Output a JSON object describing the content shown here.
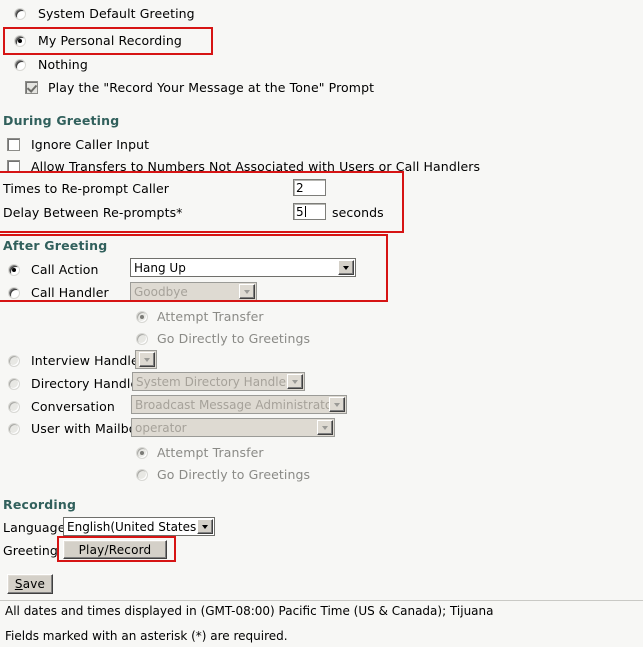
{
  "greeting_source": {
    "options": [
      {
        "label": "System Default Greeting",
        "selected": false
      },
      {
        "label": "My Personal Recording",
        "selected": true
      },
      {
        "label": "Nothing",
        "selected": false
      }
    ],
    "record_prompt_checkbox": {
      "label": "Play the \"Record Your Message at the Tone\" Prompt",
      "checked": true,
      "disabled": true
    }
  },
  "during_greeting": {
    "heading": "During Greeting",
    "ignore_caller_input": {
      "label": "Ignore Caller Input",
      "checked": false
    },
    "allow_transfers": {
      "label": "Allow Transfers to Numbers Not Associated with Users or Call Handlers",
      "checked": false
    },
    "times_to_reprompt": {
      "label": "Times to Re-prompt Caller",
      "value": "2"
    },
    "delay_between_reprompts": {
      "label": "Delay Between Re-prompts*",
      "value": "5",
      "units": "seconds"
    }
  },
  "after_greeting": {
    "heading": "After Greeting",
    "call_action": {
      "label": "Call Action",
      "selected": true,
      "value": "Hang Up",
      "disabled": false
    },
    "call_handler": {
      "label": "Call Handler",
      "selected": false,
      "value": "Goodbye",
      "disabled": true
    },
    "handler_transfer_options": [
      {
        "label": "Attempt Transfer",
        "selected": true,
        "disabled": true
      },
      {
        "label": "Go Directly to Greetings",
        "selected": false,
        "disabled": true
      }
    ],
    "interview_handler": {
      "label": "Interview Handler",
      "selected": false,
      "value": "",
      "disabled": true
    },
    "directory_handler": {
      "label": "Directory Handler",
      "selected": false,
      "value": "System Directory Handler",
      "disabled": true
    },
    "conversation": {
      "label": "Conversation",
      "selected": false,
      "value": "Broadcast Message Administrator",
      "disabled": true
    },
    "user_with_mailbox": {
      "label": "User with Mailbox",
      "selected": false,
      "value": "operator",
      "disabled": true
    },
    "mailbox_transfer_options": [
      {
        "label": "Attempt Transfer",
        "selected": true,
        "disabled": true
      },
      {
        "label": "Go Directly to Greetings",
        "selected": false,
        "disabled": true
      }
    ]
  },
  "recording": {
    "heading": "Recording",
    "language_label": "Language",
    "language_value": "English(United States)",
    "greeting_label": "Greeting",
    "play_record_button": "Play/Record"
  },
  "save_button": {
    "accesskey": "S",
    "rest": "ave"
  },
  "footer": {
    "timezone_note": "All dates and times displayed in (GMT-08:00) Pacific Time (US & Canada); Tijuana",
    "required_note": "Fields marked with an asterisk (*) are required."
  },
  "highlight_color": "#d61414"
}
